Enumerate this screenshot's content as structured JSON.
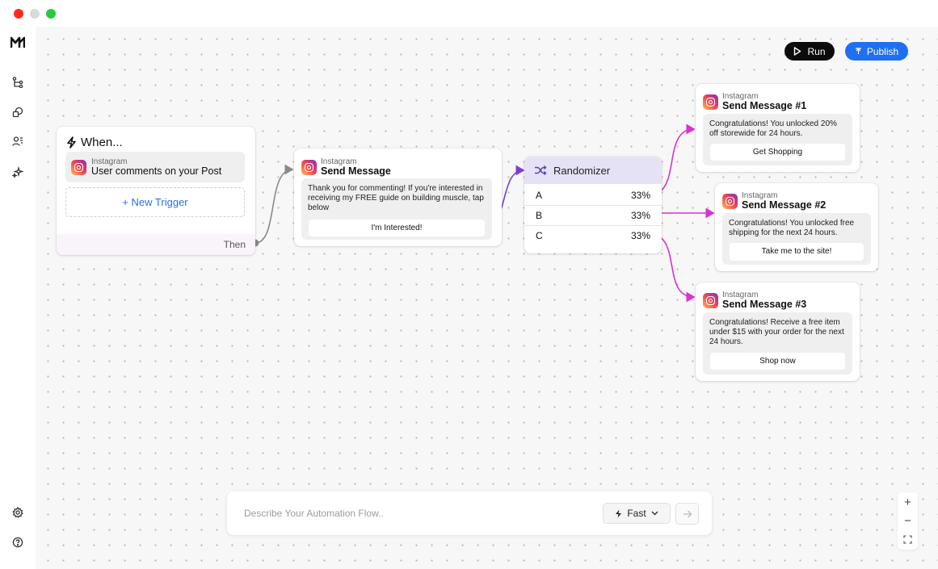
{
  "app": {
    "logo": "M"
  },
  "sidebar": {
    "items": [
      {
        "icon": "flow-icon"
      },
      {
        "icon": "shapes-icon"
      },
      {
        "icon": "users-icon"
      },
      {
        "icon": "sparkles-icon"
      }
    ],
    "bottom": [
      {
        "icon": "gear-icon"
      },
      {
        "icon": "help-icon"
      }
    ]
  },
  "toolbar": {
    "run_label": "Run",
    "publish_label": "Publish"
  },
  "trigger": {
    "title": "When...",
    "source": "Instagram",
    "event": "User comments on your Post",
    "new_trigger_label": "+ New Trigger",
    "then_label": "Then"
  },
  "send_message": {
    "source": "Instagram",
    "title": "Send Message",
    "text": "Thank you for commenting! If you're interested in receiving my FREE guide on building muscle, tap below",
    "button": "I'm Interested!"
  },
  "randomizer": {
    "title": "Randomizer",
    "rows": [
      {
        "label": "A",
        "percent": "33%"
      },
      {
        "label": "B",
        "percent": "33%"
      },
      {
        "label": "C",
        "percent": "33%"
      }
    ]
  },
  "outcomes": [
    {
      "source": "Instagram",
      "title": "Send Message  #1",
      "text": "Congratulations! You unlocked 20% off storewide for 24 hours.",
      "button": "Get Shopping"
    },
    {
      "source": "Instagram",
      "title": "Send Message #2",
      "text": "Congratulations! You unlocked free shipping for the next 24 hours.",
      "button": "Take me to the site!"
    },
    {
      "source": "Instagram",
      "title": "Send Message #3",
      "text": "Congratulations! Receive a free item under $15 with your order for the next 24 hours.",
      "button": "Shop now"
    }
  ],
  "prompt": {
    "placeholder": "Describe Your Automation Flow..",
    "mode": "Fast"
  },
  "zoom": {
    "in": "+",
    "out": "−"
  },
  "colors": {
    "accent": "#1e6ff1",
    "connector_gray": "#8a8a8a",
    "connector_purple": "#7e3fd0",
    "connector_magenta": "#d633cf",
    "randomizer_head": "#e6e2f6"
  }
}
